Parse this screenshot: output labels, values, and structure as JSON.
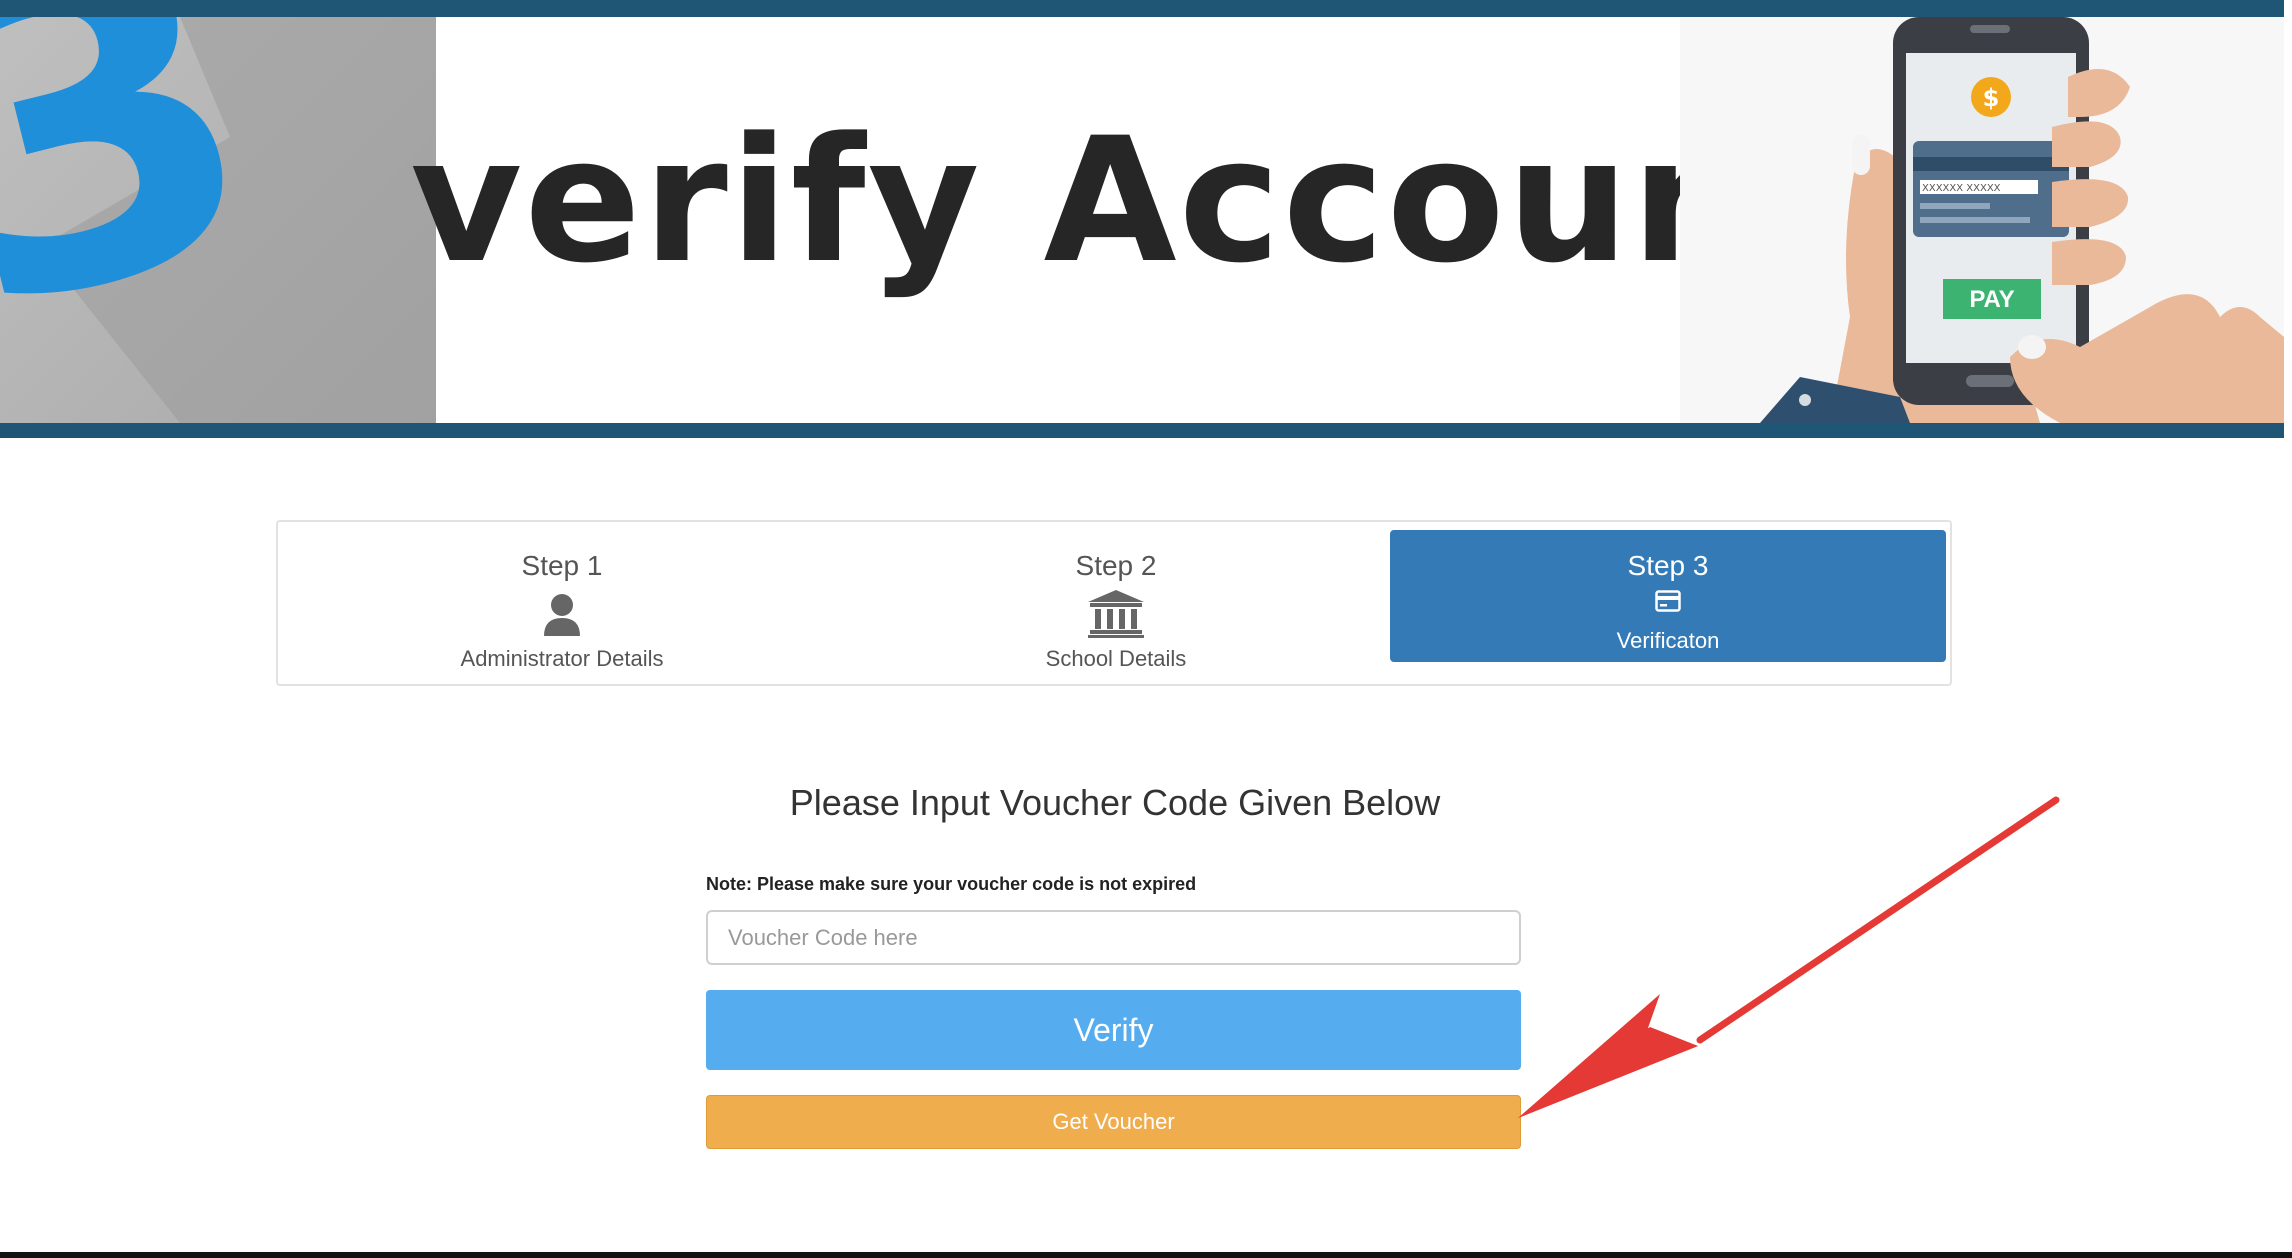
{
  "banner": {
    "step_number": "3",
    "title": "verify Account",
    "phone": {
      "card_number": "XXXXXX XXXXX",
      "pay_label": "PAY",
      "currency_symbol": "$"
    }
  },
  "stepper": {
    "steps": [
      {
        "title": "Step 1",
        "caption": "Administrator Details",
        "icon": "user-icon",
        "active": false
      },
      {
        "title": "Step 2",
        "caption": "School Details",
        "icon": "bank-icon",
        "active": false
      },
      {
        "title": "Step 3",
        "caption": "Verificaton",
        "icon": "credit-card-icon",
        "active": true
      }
    ]
  },
  "form": {
    "heading": "Please Input Voucher Code Given Below",
    "note": "Note: Please make sure your voucher code is not expired",
    "voucher_placeholder": "Voucher Code here",
    "voucher_value": "",
    "verify_label": "Verify",
    "get_voucher_label": "Get Voucher"
  },
  "colors": {
    "banner_bar": "#1f5676",
    "step_active": "#337ab7",
    "verify_button": "#55acee",
    "get_voucher_button": "#f0ad4e",
    "annotation_arrow": "#e53935"
  }
}
